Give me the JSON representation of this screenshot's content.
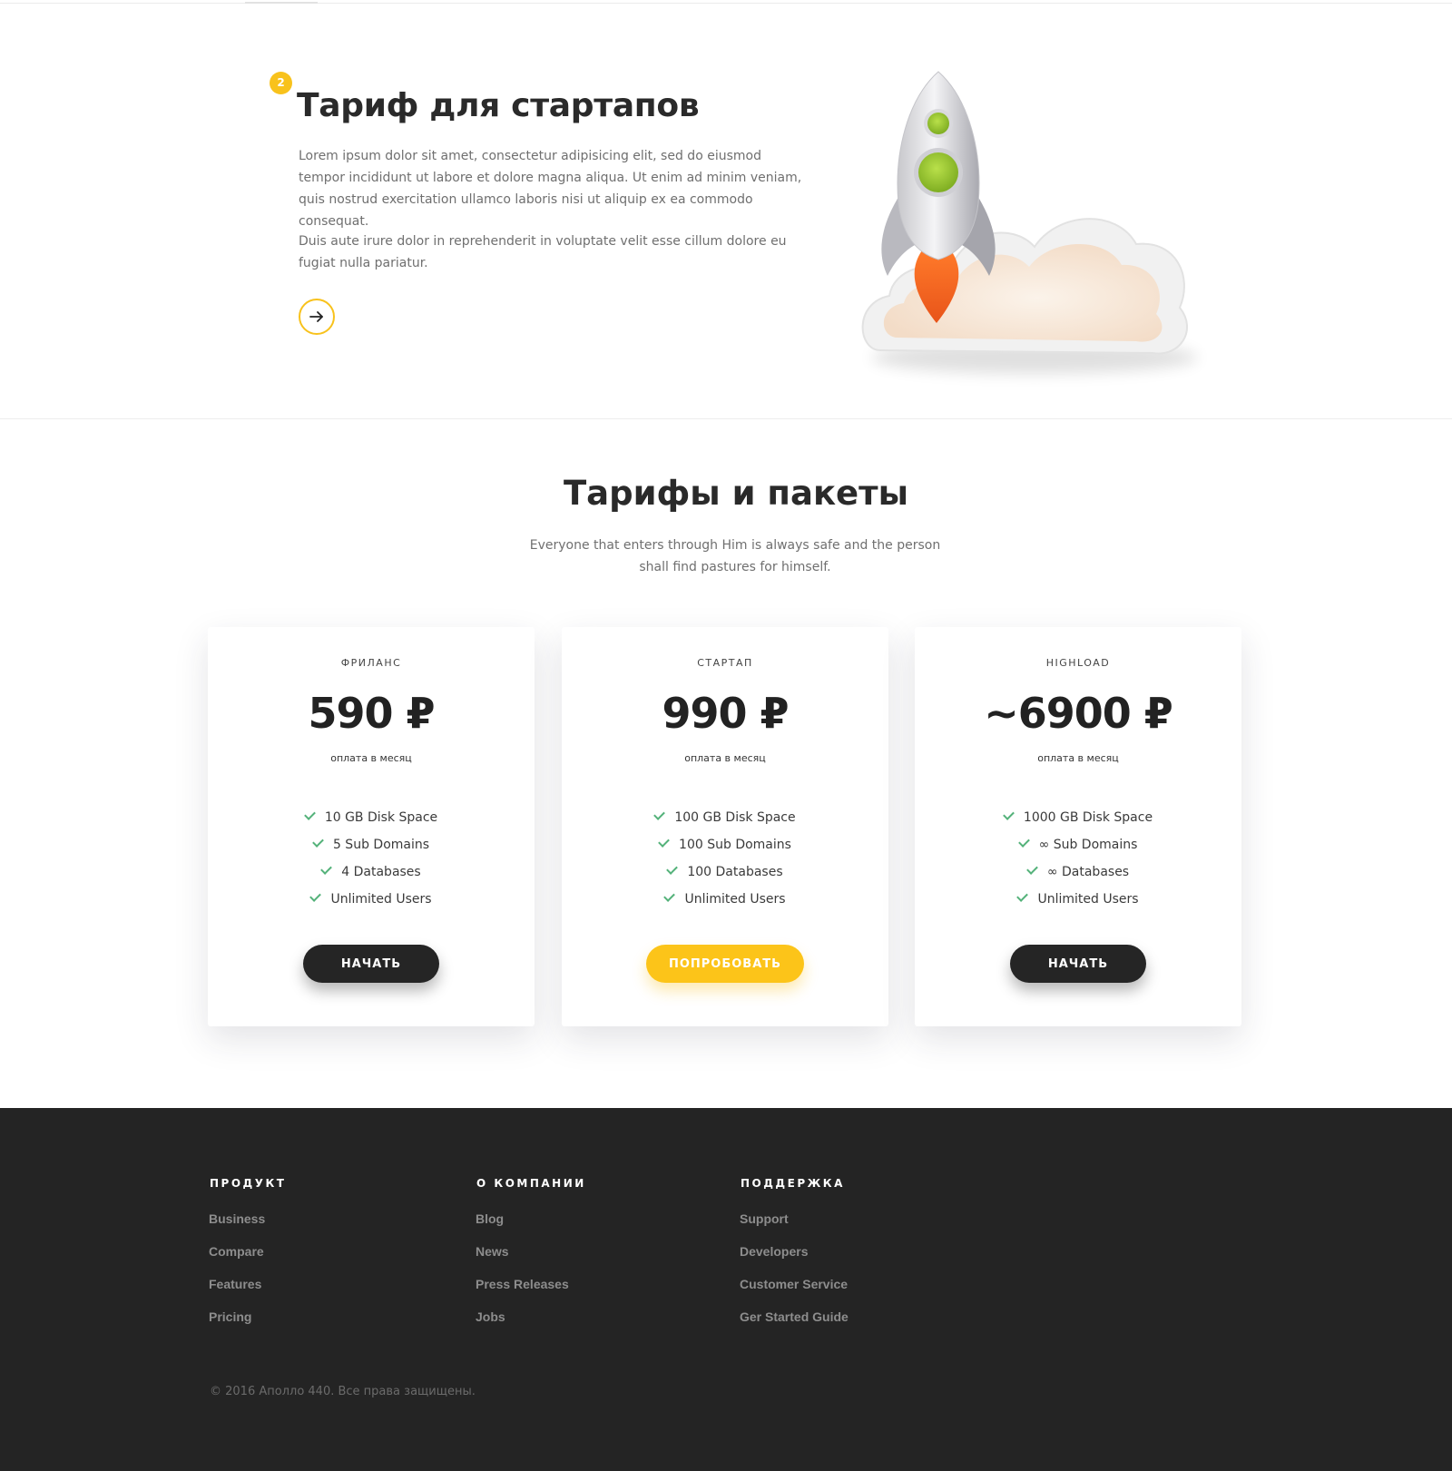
{
  "hero": {
    "step_number": "2",
    "title": "Тариф для стартапов",
    "paragraph_1": "Lorem ipsum dolor sit amet, consectetur adipisicing elit, sed do eiusmod tempor incididunt ut labore et dolore magna aliqua. Ut enim ad minim veniam, quis nostrud exercitation ullamco laboris nisi ut aliquip ex ea commodo consequat.",
    "paragraph_2": "Duis aute irure dolor in reprehenderit in voluptate velit esse cillum dolore eu fugiat nulla pariatur.",
    "arrow_icon": "arrow-right-icon",
    "illustration": "rocket-cloud-illustration"
  },
  "pricing": {
    "title": "Тарифы и пакеты",
    "subtitle": "Everyone that enters through Him is always safe and the person shall find pastures for himself.",
    "plans": [
      {
        "name": "ФРИЛАНС",
        "price": "590 ₽",
        "period": "оплата в месяц",
        "features": [
          "10 GB Disk Space",
          "5 Sub Domains",
          "4 Databases",
          "Unlimited Users"
        ],
        "cta": "НАЧАТЬ"
      },
      {
        "name": "СТАРТАП",
        "price": "990 ₽",
        "period": "оплата в месяц",
        "features": [
          "100 GB Disk Space",
          "100 Sub Domains",
          "100 Databases",
          "Unlimited Users"
        ],
        "cta": "ПОПРОБОВАТЬ"
      },
      {
        "name": "HIGHLOAD",
        "price": "~6900 ₽",
        "period": "оплата в месяц",
        "features": [
          "1000 GB Disk Space",
          "∞ Sub Domains",
          "∞ Databases",
          "Unlimited Users"
        ],
        "cta": "НАЧАТЬ"
      }
    ],
    "check_icon": "check-icon"
  },
  "footer": {
    "columns": [
      {
        "heading": "ПРОДУКТ",
        "links": [
          "Business",
          "Compare",
          "Features",
          "Pricing"
        ]
      },
      {
        "heading": "О КОМПАНИИ",
        "links": [
          "Blog",
          "News",
          "Press Releases",
          "Jobs"
        ]
      },
      {
        "heading": "ПОДДЕРЖКА",
        "links": [
          "Support",
          "Developers",
          "Customer Service",
          "Ger Started Guide"
        ]
      }
    ],
    "copyright": "© 2016 Аполло 440. Все права защищены."
  },
  "colors": {
    "accent_yellow": "#f8c21c",
    "dark_button": "#252525",
    "check_green": "#54b27a",
    "footer_bg": "#242424"
  }
}
